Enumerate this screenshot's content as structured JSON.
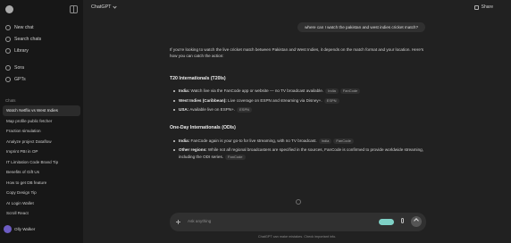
{
  "sidebar": {
    "nav": [
      {
        "label": "New chat",
        "icon": "edit-icon"
      },
      {
        "label": "Search chats",
        "icon": "search-icon"
      },
      {
        "label": "Library",
        "icon": "library-icon"
      },
      {
        "label": "Sora",
        "icon": "sora-icon"
      },
      {
        "label": "GPTs",
        "icon": "gpts-icon"
      }
    ],
    "history_heading": "Chats",
    "history": [
      "Watch Netflix vs West Indies",
      "Map profile public fetcher",
      "Fraction simulation",
      "Analyze project Dataflow",
      "Imprint PBI in OP",
      "IT Limitation Code Brand Tip",
      "Benefits of Gift Us",
      "How to get DB feature",
      "Copy Design Tip",
      "AI Login Wallet",
      "Scroll React"
    ],
    "user": "Olly Walker"
  },
  "header": {
    "model": "ChatGPT",
    "share": "Share"
  },
  "conversation": {
    "user_message": "where can I watch the pakistan and west indies cricket match?",
    "intro": "If you're looking to watch the live cricket match between Pakistan and West Indies, it depends on the match format and your location. Here's how you can catch the action:",
    "sections": [
      {
        "heading": "T20 Internationals (T20Is)",
        "bullets": [
          {
            "bold": "India:",
            "text": " Watch live via the FanCode app or website — no TV broadcast available.",
            "chips": [
              "India",
              "FanCode"
            ]
          },
          {
            "bold": "West Indies (Caribbean):",
            "text": " Live coverage on ESPN and streaming via Disney+.",
            "chips": [
              "ESPN"
            ]
          },
          {
            "bold": "USA:",
            "text": " Available live on ESPN+.",
            "chips": [
              "ESPN"
            ]
          }
        ]
      },
      {
        "heading": "One-Day Internationals (ODIs)",
        "bullets": [
          {
            "bold": "India:",
            "text": " FanCode again is your go-to for live streaming, with no TV broadcast.",
            "chips": [
              "India",
              "FanCode"
            ]
          },
          {
            "bold": "Other regions:",
            "text": " While not all regional broadcasters are specified in the sources, FanCode is confirmed to provide worldwide streaming, including the ODI series.",
            "chips": [
              "FanCode"
            ]
          }
        ]
      }
    ]
  },
  "composer": {
    "placeholder": "Ask anything"
  },
  "footer": "ChatGPT can make mistakes. Check important info.",
  "colors": {
    "sidebar_bg": "#171717",
    "main_bg": "#212121",
    "accent": "#7fd1c6"
  }
}
